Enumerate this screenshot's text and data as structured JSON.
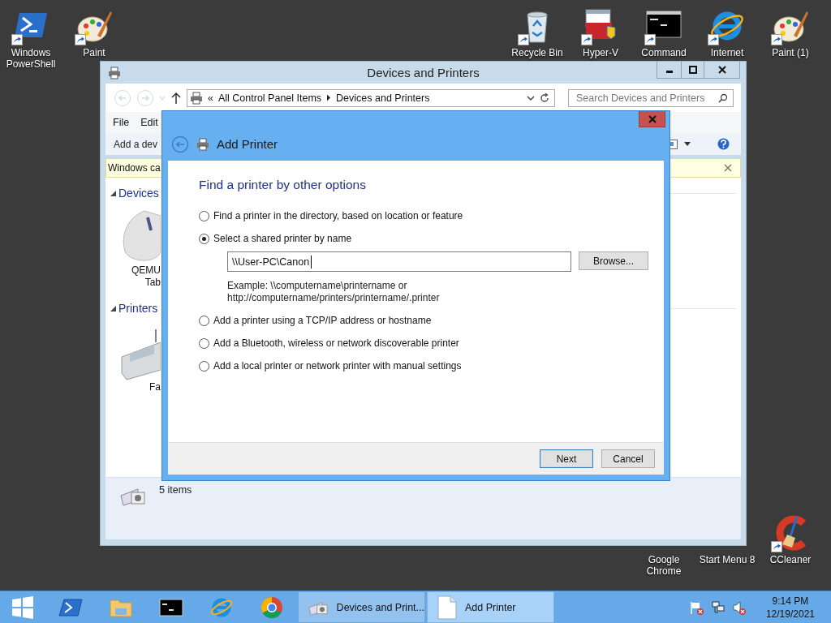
{
  "desktop": {
    "top_left": [
      {
        "label": "Windows PowerShell",
        "kind": "powershell"
      },
      {
        "label": "Paint",
        "kind": "paint"
      }
    ],
    "top_right": [
      {
        "label": "Recycle Bin",
        "kind": "recycle"
      },
      {
        "label": "Hyper-V",
        "kind": "toolbox"
      },
      {
        "label": "Command",
        "kind": "console"
      },
      {
        "label": "Internet",
        "kind": "globe"
      },
      {
        "label": "Paint (1)",
        "kind": "paint"
      }
    ],
    "bottom_right": [
      {
        "label": "Google Chrome",
        "kind": "covered"
      },
      {
        "label": "Start Menu 8",
        "kind": "covered"
      },
      {
        "label": "CCleaner",
        "kind": "cleaner"
      }
    ]
  },
  "explorer": {
    "title": "Devices and Printers",
    "address": {
      "overflow": "«",
      "crumbs": [
        "All Control Panel Items",
        "Devices and Printers"
      ]
    },
    "search": {
      "placeholder": "Search Devices and Printers"
    },
    "menu": [
      "File",
      "Edit"
    ],
    "toolbar": [
      "Add a dev"
    ],
    "infobar": "Windows ca",
    "groups": [
      {
        "name": "Devices",
        "expanded": true,
        "items": [
          {
            "kind": "mouse",
            "label": [
              "QEMU",
              "Tab"
            ]
          }
        ]
      },
      {
        "name": "Printers",
        "expanded": true,
        "items": [
          {
            "kind": "fax",
            "label": [
              "Fa"
            ]
          }
        ]
      }
    ],
    "details": "5 items"
  },
  "dialog": {
    "title": "Add Printer",
    "heading": "Find a printer by other options",
    "options": [
      {
        "label": "Find a printer in the directory, based on location or feature",
        "selected": false
      },
      {
        "label": "Select a shared printer by name",
        "selected": true,
        "field": {
          "value": "\\\\User-PC\\Canon",
          "browse": "Browse...",
          "example": [
            "Example: \\\\computername\\printername or",
            "http://computername/printers/printername/.printer"
          ]
        }
      },
      {
        "label": "Add a printer using a TCP/IP address or hostname",
        "selected": false
      },
      {
        "label": "Add a Bluetooth, wireless or network discoverable printer",
        "selected": false
      },
      {
        "label": "Add a local printer or network printer with manual settings",
        "selected": false
      }
    ],
    "buttons": [
      {
        "label": "Next",
        "default": true
      },
      {
        "label": "Cancel",
        "default": false
      }
    ]
  },
  "taskbar": {
    "pinned": [
      {
        "kind": "start"
      },
      {
        "kind": "powershell"
      },
      {
        "kind": "folder"
      },
      {
        "kind": "console"
      },
      {
        "kind": "globe"
      },
      {
        "kind": "ring"
      }
    ],
    "tasks": [
      {
        "label": "Devices and Print...",
        "kind": "printer",
        "selected": false
      },
      {
        "label": "Add Printer",
        "kind": "page",
        "selected": true
      }
    ],
    "tray": [
      {
        "kind": "flag"
      },
      {
        "kind": "network"
      },
      {
        "kind": "speaker"
      }
    ],
    "time": "9:14 PM",
    "date": "12/19/2021"
  }
}
